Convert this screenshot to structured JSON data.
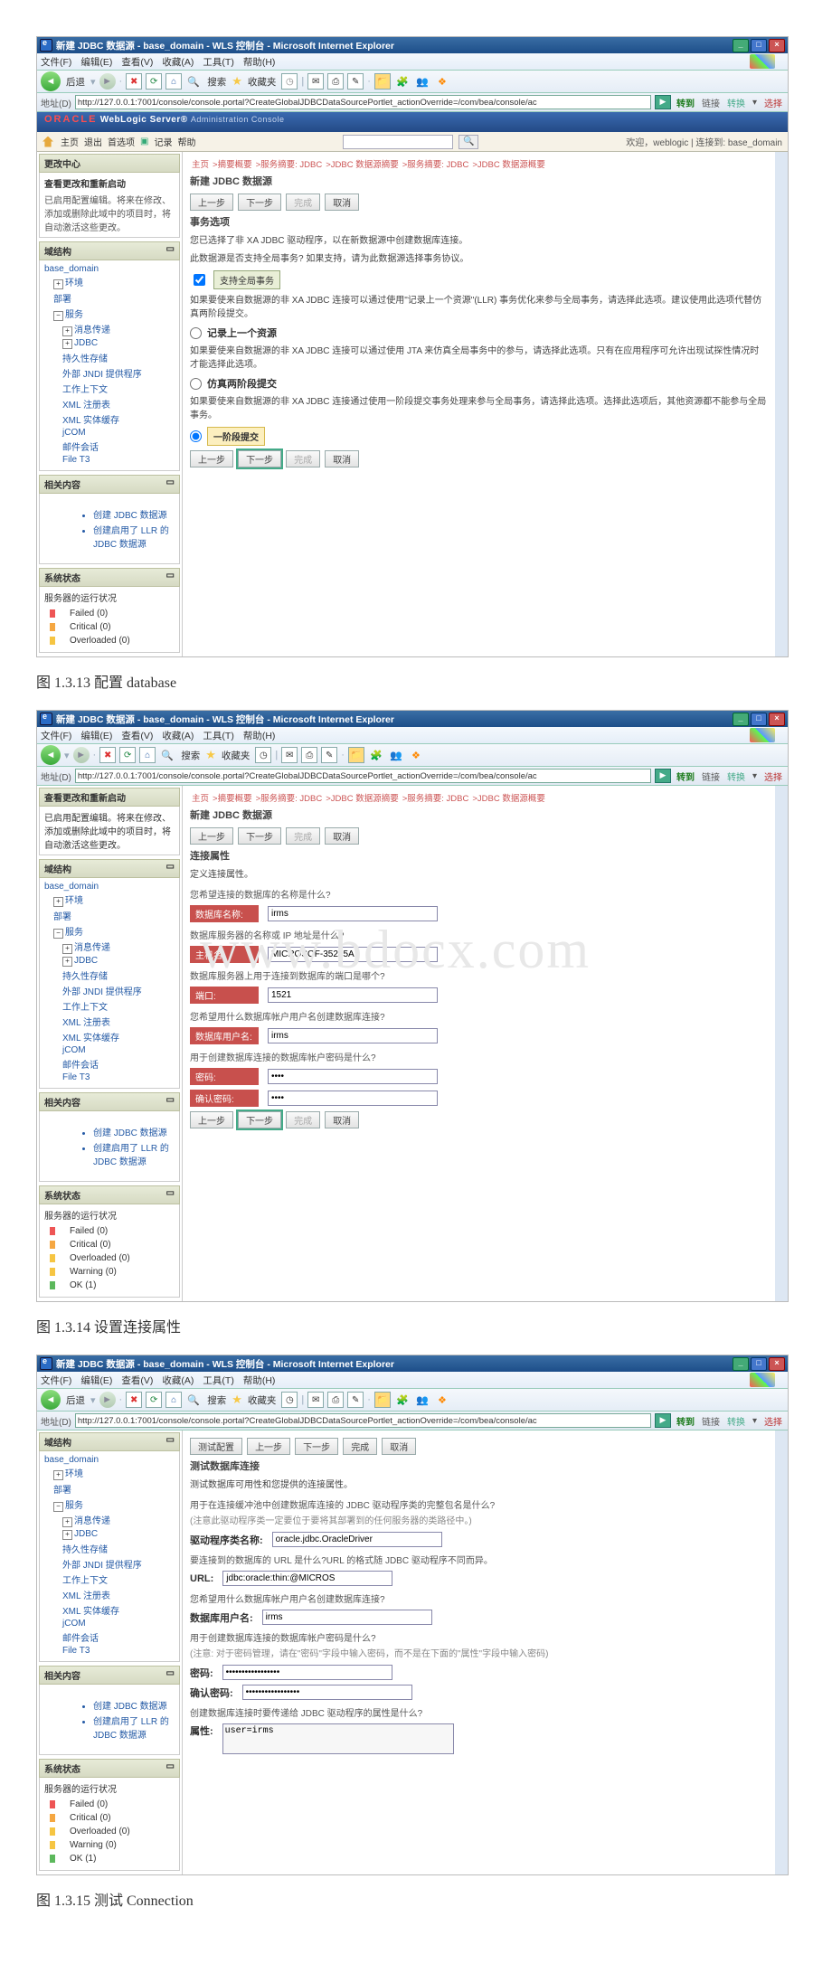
{
  "captions": {
    "fig1": "图 1.3.13 配置 database",
    "fig2": "图 1.3.14 设置连接属性",
    "fig3": "图 1.3.15 测试 Connection"
  },
  "window_title": "新建 JDBC 数据源 - base_domain - WLS 控制台 - Microsoft Internet Explorer",
  "ie_menu": {
    "file": "文件(F)",
    "edit": "编辑(E)",
    "view": "查看(V)",
    "fav": "收藏(A)",
    "tools": "工具(T)",
    "help": "帮助(H)"
  },
  "ie_tool": {
    "back": "后退",
    "search": "搜索",
    "fav": "收藏夹"
  },
  "addrbar": {
    "label": "地址(D)",
    "url": "http://127.0.0.1:7001/console/console.portal?CreateGlobalJDBCDataSourcePortlet_actionOverride=/com/bea/console/ac",
    "go": "转到",
    "links": "链接",
    "swap": "转换",
    "select": "选择"
  },
  "oracle_header": {
    "brand": "ORACLE",
    "product": "WebLogic Server®",
    "suffix": "Administration Console"
  },
  "topbar": {
    "home": "主页",
    "logout": "退出",
    "pref": "首选项",
    "record": "记录",
    "help": "帮助",
    "welcome": "欢迎，weblogic",
    "connected": "连接到: base_domain"
  },
  "left": {
    "change_center": "更改中心",
    "view_changes": "查看更改和重新启动",
    "view_changes_desc": "已启用配置编辑。将来在修改、添加或删除此域中的项目时，将自动激活这些更改。",
    "domain_struct": "域结构",
    "tree": {
      "root": "base_domain",
      "env": "环境",
      "deploy": "部署",
      "services": "服务",
      "messaging": "消息传递",
      "jdbc": "JDBC",
      "persist": "持久性存储",
      "jndi": "外部 JNDI 提供程序",
      "workctx": "工作上下文",
      "xmlreg": "XML 注册表",
      "xmlent": "XML 实体缓存",
      "jcom": "jCOM",
      "mail": "邮件会话",
      "filet3": "File T3"
    },
    "related": "相关内容",
    "rel1": "创建 JDBC 数据源",
    "rel2": "创建启用了 LLR 的 JDBC 数据源",
    "sys_status": "系统状态",
    "srv_status": "服务器的运行状况",
    "failed": "Failed (0)",
    "critical": "Critical (0)",
    "overloaded": "Overloaded (0)",
    "warning": "Warning (0)",
    "ok": "OK (1)"
  },
  "breadcrumb": {
    "home": "主页",
    "summary": ">摘要概要",
    "servers": ">服务摘要: JDBC",
    "jdbc": ">JDBC 数据源摘要",
    "servers2": ">服务摘要: JDBC",
    "jdbc2": ">JDBC 数据源概要"
  },
  "shot1": {
    "title": "新建 JDBC 数据源",
    "btn_prev": "上一步",
    "btn_next": "下一步",
    "btn_finish": "完成",
    "btn_cancel": "取消",
    "sect": "事务选项",
    "p1": "您已选择了非 XA JDBC 驱动程序，以在新数据源中创建数据库连接。",
    "p2": "此数据源是否支持全局事务? 如果支持，请为此数据源选择事务协议。",
    "chk": "支持全局事务",
    "opt1_title": "记录上一个资源",
    "opt1_desc": "如果要使来自数据源的非 XA JDBC 连接可以通过使用\"记录上一个资源\"(LLR) 事务优化来参与全局事务，请选择此选项。建议使用此选项代替仿真两阶段提交。",
    "opt2_desc": "如果要使来自数据源的非 XA JDBC 连接可以通过使用 JTA 来仿真全局事务中的参与，请选择此选项。只有在应用程序可允许出现试探性情况时才能选择此选项。",
    "opt2_title": "仿真两阶段提交",
    "opt3_desc": "如果要使来自数据源的非 XA JDBC 连接通过使用一阶段提交事务处理来参与全局事务，请选择此选项。选择此选项后，其他资源都不能参与全局事务。",
    "opt3_title": "一阶段提交"
  },
  "shot2": {
    "title": "新建 JDBC 数据源",
    "sect": "连接属性",
    "sect2": "定义连接属性。",
    "q_name": "您希望连接的数据库的名称是什么?",
    "lab_dbname": "数据库名称:",
    "val_dbname": "irms",
    "q_host": "数据库服务器的名称或 IP 地址是什么?",
    "lab_host": "主机名:",
    "val_host": "MICROSOF-35245A",
    "q_port": "数据库服务器上用于连接到数据库的端口是哪个?",
    "lab_port": "端口:",
    "val_port": "1521",
    "q_user": "您希望用什么数据库帐户用户名创建数据库连接?",
    "lab_user": "数据库用户名:",
    "val_user": "irms",
    "q_pwd": "用于创建数据库连接的数据库帐户密码是什么?",
    "lab_pwd": "密码:",
    "lab_pwd2": "确认密码:",
    "pwd_mask": "••••",
    "btn_prev": "上一步",
    "btn_next": "下一步",
    "btn_finish": "完成",
    "btn_cancel": "取消"
  },
  "shot3": {
    "btn_test": "测试配置",
    "btn_prev": "上一步",
    "btn_next": "下一步",
    "btn_finish": "完成",
    "btn_cancel": "取消",
    "sect": "测试数据库连接",
    "p1": "测试数据库可用性和您提供的连接属性。",
    "q_driver": "用于在连接缓冲池中创建数据库连接的 JDBC 驱动程序类的完整包名是什么?",
    "note_driver": "(注意此驱动程序类一定要位于要将其部署到的任何服务器的类路径中。)",
    "lab_driver": "驱动程序类名称:",
    "val_driver": "oracle.jdbc.OracleDriver",
    "q_url": "要连接到的数据库的 URL 是什么?URL 的格式随 JDBC 驱动程序不同而异。",
    "lab_url": "URL:",
    "val_url": "jdbc:oracle:thin:@MICROS",
    "q_user": "您希望用什么数据库帐户用户名创建数据库连接?",
    "lab_user": "数据库用户名:",
    "val_user": "irms",
    "q_pwd": "用于创建数据库连接的数据库帐户密码是什么?",
    "note_pwd": "(注意: 对于密码管理，请在\"密码\"字段中输入密码，而不是在下面的\"属性\"字段中输入密码)",
    "lab_pwd": "密码:",
    "lab_pwd2": "确认密码:",
    "pwd_mask": "•••••••••••••••••",
    "q_props": "创建数据库连接时要传递给 JDBC 驱动程序的属性是什么?",
    "lab_props": "属性:",
    "val_props": "user=irms"
  },
  "watermark": "www.bdocx.com"
}
